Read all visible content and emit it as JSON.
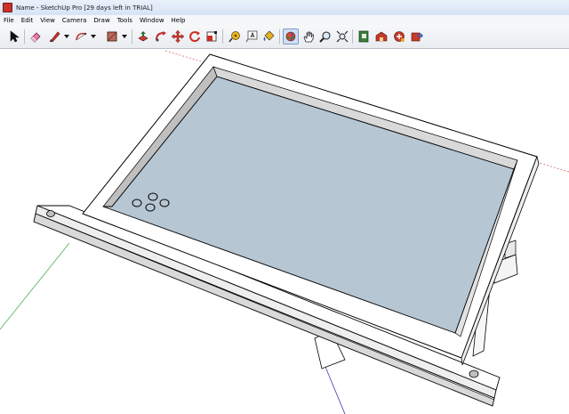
{
  "window": {
    "title": "Name - SketchUp Pro [29 days left in TRIAL]"
  },
  "menu": {
    "items": [
      "File",
      "Edit",
      "View",
      "Camera",
      "Draw",
      "Tools",
      "Window",
      "Help"
    ]
  },
  "toolbar": {
    "tools": [
      {
        "name": "select-tool",
        "icon": "arrow-cursor-icon"
      },
      {
        "name": "eraser-tool",
        "icon": "eraser-icon"
      },
      {
        "name": "line-tool",
        "icon": "pencil-icon"
      },
      {
        "name": "arc-tool",
        "icon": "arc-icon"
      },
      {
        "name": "rectangle-tool",
        "icon": "rectangle-icon"
      },
      {
        "name": "push-pull-tool",
        "icon": "push-pull-icon"
      },
      {
        "name": "follow-me-tool",
        "icon": "follow-me-icon"
      },
      {
        "name": "move-tool",
        "icon": "move-arrows-icon"
      },
      {
        "name": "rotate-tool",
        "icon": "rotate-icon"
      },
      {
        "name": "scale-tool",
        "icon": "scale-icon"
      },
      {
        "name": "tape-measure-tool",
        "icon": "tape-measure-icon"
      },
      {
        "name": "text-tool",
        "icon": "text-label-icon"
      },
      {
        "name": "paint-bucket-tool",
        "icon": "paint-bucket-icon"
      },
      {
        "name": "orbit-tool",
        "icon": "orbit-icon",
        "active": true
      },
      {
        "name": "pan-tool",
        "icon": "hand-icon"
      },
      {
        "name": "zoom-tool",
        "icon": "magnifier-icon"
      },
      {
        "name": "zoom-extents-tool",
        "icon": "zoom-extents-icon"
      },
      {
        "name": "components-tool",
        "icon": "component-book-icon"
      },
      {
        "name": "3d-warehouse-tool",
        "icon": "warehouse-icon"
      },
      {
        "name": "extension-warehouse-tool",
        "icon": "extension-warehouse-icon"
      },
      {
        "name": "share-model-tool",
        "icon": "share-model-icon"
      }
    ]
  },
  "colors": {
    "axis_red": "#d86a6a",
    "axis_green": "#4caf4c",
    "axis_blue": "#3c3cb4",
    "face_blue_gray": "#b6c6d3",
    "wall_light": "#d9d9d9",
    "wall_mid": "#bfbfbf",
    "edge": "#000000"
  }
}
